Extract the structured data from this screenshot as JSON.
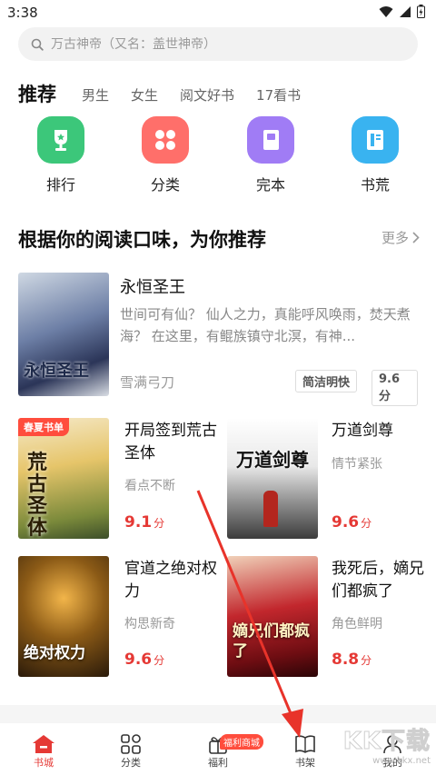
{
  "status": {
    "time": "3:38"
  },
  "search": {
    "placeholder": "万古神帝（又名：盖世神帝）"
  },
  "tabs": {
    "active": "推荐",
    "items": [
      "男生",
      "女生",
      "阅文好书",
      "17看书"
    ]
  },
  "quick": [
    {
      "label": "排行",
      "icon": "trophy-icon",
      "color": "#3cc77a"
    },
    {
      "label": "分类",
      "icon": "grid-icon",
      "color": "#ff6f6a"
    },
    {
      "label": "完本",
      "icon": "book-icon",
      "color": "#a07cf5"
    },
    {
      "label": "书荒",
      "icon": "booklist-icon",
      "color": "#39b3f0"
    }
  ],
  "section": {
    "title": "根据你的阅读口味，为你推荐",
    "more": "更多"
  },
  "featured": {
    "title": "永恒圣王",
    "description": "世间可有仙？ 仙人之力，真能呼风唤雨，焚天煮海？ 在这里，有鲲族镇守北溟，有神...",
    "author": "雪满弓刀",
    "tag": "简洁明快",
    "score": "9.6分",
    "cover_text": "永恒圣王"
  },
  "books": [
    {
      "title": "开局签到荒古圣体",
      "sub": "看点不断",
      "score": "9.1",
      "unit": "分",
      "cover_text": "荒古圣体",
      "badge": "春夏书单"
    },
    {
      "title": "万道剑尊",
      "sub": "情节紧张",
      "score": "9.6",
      "unit": "分",
      "cover_text": "万道剑尊"
    },
    {
      "title": "官道之绝对权力",
      "sub": "构思新奇",
      "score": "9.6",
      "unit": "分",
      "cover_text": "绝对权力"
    },
    {
      "title": "我死后，嫡兄们都疯了",
      "sub": "角色鲜明",
      "score": "8.8",
      "unit": "分",
      "cover_text": "嫡兄们都疯了"
    }
  ],
  "nav": {
    "items": [
      "书城",
      "分类",
      "福利",
      "书架",
      "我的"
    ],
    "badge": "福利商城",
    "active_color": "#e53935"
  },
  "watermark": "KK下载",
  "watermark_url": "www.kkx.net"
}
